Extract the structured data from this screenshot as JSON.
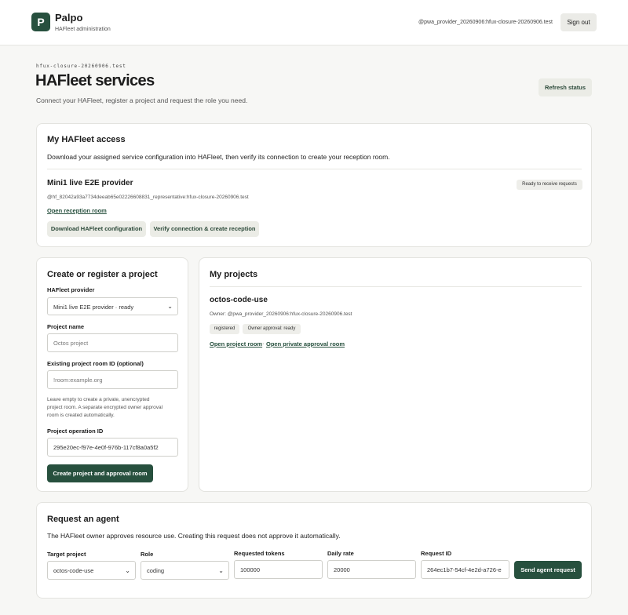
{
  "brand": {
    "logo_letter": "P",
    "title": "Palpo",
    "subtitle": "HAFleet administration"
  },
  "user": {
    "id": "@pwa_provider_20260906:hfux-closure-20260906.test",
    "signout_label": "Sign out"
  },
  "page": {
    "eyebrow": "hfux-closure-20260906.test",
    "title": "HAFleet services",
    "description": "Connect your HAFleet, register a project and request the role you need.",
    "refresh_label": "Refresh status"
  },
  "access": {
    "title": "My HAFleet access",
    "description": "Download your assigned service configuration into HAFleet, then verify its connection to create your reception room.",
    "provider_name": "Mini1 live E2E provider",
    "provider_status": "Ready to receive requests",
    "provider_id": "@hf_82042a93a7734deeab65e02226608831_representative:hfux-closure-20260906.test",
    "open_room_link": "Open reception room",
    "download_label": "Download HAFleet configuration",
    "verify_label": "Verify connection & create reception"
  },
  "create": {
    "title": "Create or register a project",
    "provider_label": "HAFleet provider",
    "provider_value": "Mini1 live E2E provider · ready",
    "name_label": "Project name",
    "name_placeholder": "Octos project",
    "room_label": "Existing project room ID (optional)",
    "room_placeholder": "!room:example.org",
    "help_line1": "Leave empty to create a private, unencrypted",
    "help_line2": "project room. A separate encrypted owner approval",
    "help_line3": "room is created automatically.",
    "opid_label": "Project operation ID",
    "opid_value": "295e20ec-f97e-4e0f-976b-117cf8a0a5f2",
    "submit_label": "Create project and approval room"
  },
  "projects": {
    "title": "My projects",
    "items": [
      {
        "name": "octos-code-use",
        "owner": "Owner: @pwa_provider_20260906:hfux-closure-20260906.test",
        "badge_status": "registered",
        "badge_approval": "Owner approval: ready",
        "link_project": "Open project room",
        "separator": "·",
        "link_approval": "Open private approval room"
      }
    ]
  },
  "agent": {
    "title": "Request an agent",
    "description": "The HAFleet owner approves resource use. Creating this request does not approve it automatically.",
    "target_label": "Target project",
    "target_value": "octos-code-use",
    "role_label": "Role",
    "role_value": "coding",
    "tokens_label": "Requested tokens",
    "tokens_value": "100000",
    "rate_label": "Daily rate",
    "rate_value": "20000",
    "reqid_label": "Request ID",
    "reqid_value": "264ec1b7-54cf-4e2d-a726-e",
    "send_label": "Send agent request"
  },
  "icons": {
    "select_arrow": "chevron-down-icon"
  },
  "colors": {
    "accent": "#27503e",
    "background": "#f7f7f5",
    "secondary_button": "#ebece6"
  }
}
